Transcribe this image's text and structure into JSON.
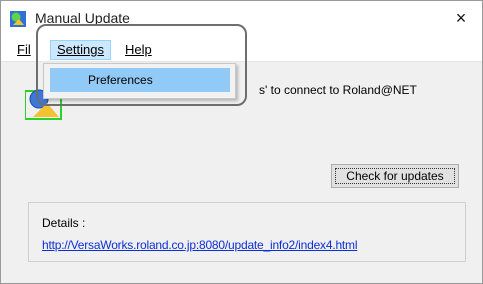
{
  "window": {
    "title": "Manual Update",
    "close_glyph": "×",
    "icon": "app-globe-icon"
  },
  "menubar": {
    "file_partial": "Fil",
    "settings_label": "Settings",
    "help_label": "Help"
  },
  "dropdown": {
    "items": [
      {
        "label": "Preferences"
      }
    ]
  },
  "message": {
    "visible_tail": "s' to connect to Roland@NET"
  },
  "buttons": {
    "check_updates_label": "Check for updates"
  },
  "details": {
    "label": "Details :",
    "link": "http://VersaWorks.roland.co.jp:8080/update_info2/index4.html"
  },
  "colors": {
    "menu_highlight": "#cce8ff",
    "dropdown_highlight": "#91c9f7",
    "link": "#0b2fd6",
    "callout_border": "#6e6e6e"
  }
}
